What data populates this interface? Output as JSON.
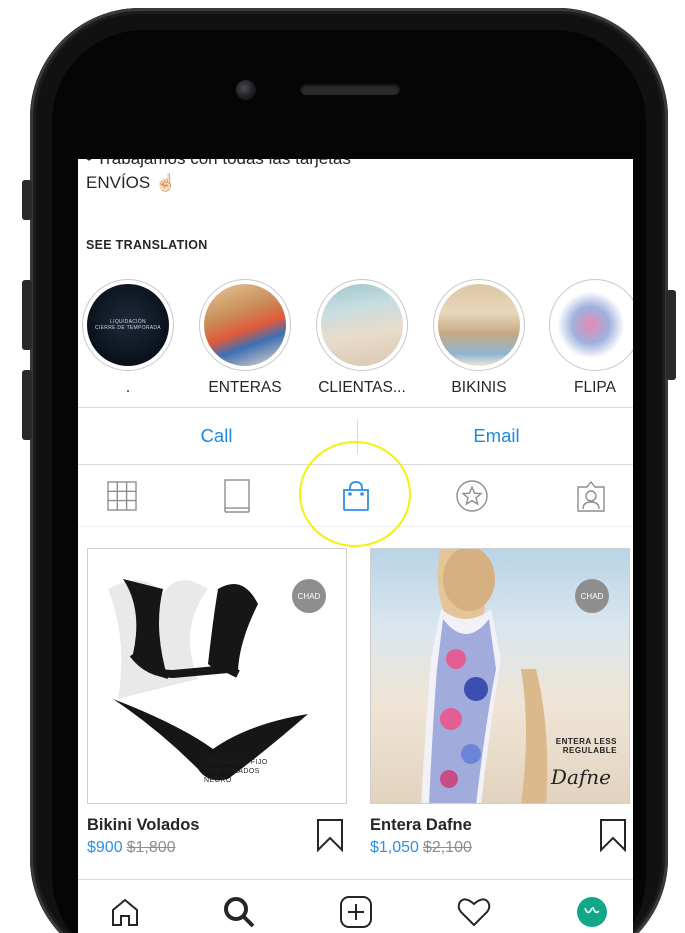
{
  "bio": {
    "clipped_line": "• Trabajamos con todas las tarjetas",
    "line2": "ENVÍOS ☝🏻",
    "see_translation": "SEE TRANSLATION"
  },
  "highlights": [
    {
      "label": ".",
      "cover_text": [
        "LIQUIDACIÓN",
        "CIERRE DE TEMPORADA"
      ]
    },
    {
      "label": "ENTERAS"
    },
    {
      "label": "CLIENTAS..."
    },
    {
      "label": "BIKINIS"
    },
    {
      "label": "FLIPA"
    }
  ],
  "contact": {
    "call": "Call",
    "email": "Email"
  },
  "tabs": [
    "grid-icon",
    "igtv-icon",
    "shopping-bag-icon",
    "star-icon",
    "tagged-icon"
  ],
  "products": [
    {
      "title": "Bikini Volados",
      "price": "$900",
      "old_price": "$1,800",
      "badge": "CHAD",
      "caption": [
        "TRIÁNGULO FIJO",
        "CON VOLADOS",
        "NEGRO"
      ]
    },
    {
      "title": "Entera Dafne",
      "price": "$1,050",
      "old_price": "$2,100",
      "badge": "CHAD",
      "caption": [
        "ENTERA LESS",
        "REGULABLE"
      ],
      "script": "Dafne"
    }
  ],
  "nav": [
    "home-icon",
    "search-icon",
    "new-post-icon",
    "activity-heart-icon",
    "profile-avatar"
  ],
  "colors": {
    "link_blue": "#1b8ae0",
    "price_blue": "#2e8fe6",
    "focus_ring": "#f6f00f",
    "avatar": "#11a889"
  }
}
